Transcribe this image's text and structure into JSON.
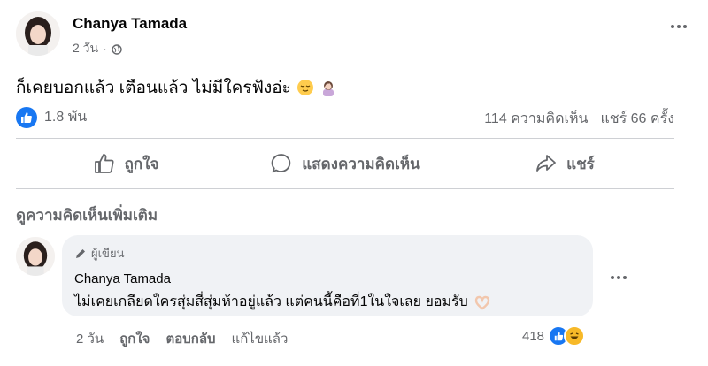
{
  "post": {
    "author": "Chanya Tamada",
    "time": "2 วัน",
    "dot": "·",
    "text": "ก็เคยบอกแล้ว เตือนแล้ว ไม่มีใครฟังอ่ะ",
    "emoji_1": "relieved-face-emoji",
    "emoji_2": "person-facepalming-emoji"
  },
  "reactions": {
    "count": "1.8 พัน",
    "comments": "114 ความคิดเห็น",
    "shares": "แชร์ 66 ครั้ง"
  },
  "actions": {
    "like": "ถูกใจ",
    "comment": "แสดงความคิดเห็น",
    "share": "แชร์"
  },
  "more_comments": "ดูความคิดเห็นเพิ่มเติม",
  "comment": {
    "badge": "ผู้เขียน",
    "author": "Chanya Tamada",
    "text": "ไม่เคยเกลียดใครสุ่มสี่สุ่มห้าอยู่แล้ว แต่คนนี้คือที่1ในใจเลย ยอมรับ",
    "emoji": "heart-hands-emoji",
    "time": "2 วัน",
    "like": "ถูกใจ",
    "reply": "ตอบกลับ",
    "edited": "แก้ไขแล้ว",
    "reaction_count": "418"
  },
  "colors": {
    "primary": "#1877f2",
    "secondary_text": "#65676b",
    "bubble": "#f0f2f5",
    "divider": "#ced0d4"
  }
}
